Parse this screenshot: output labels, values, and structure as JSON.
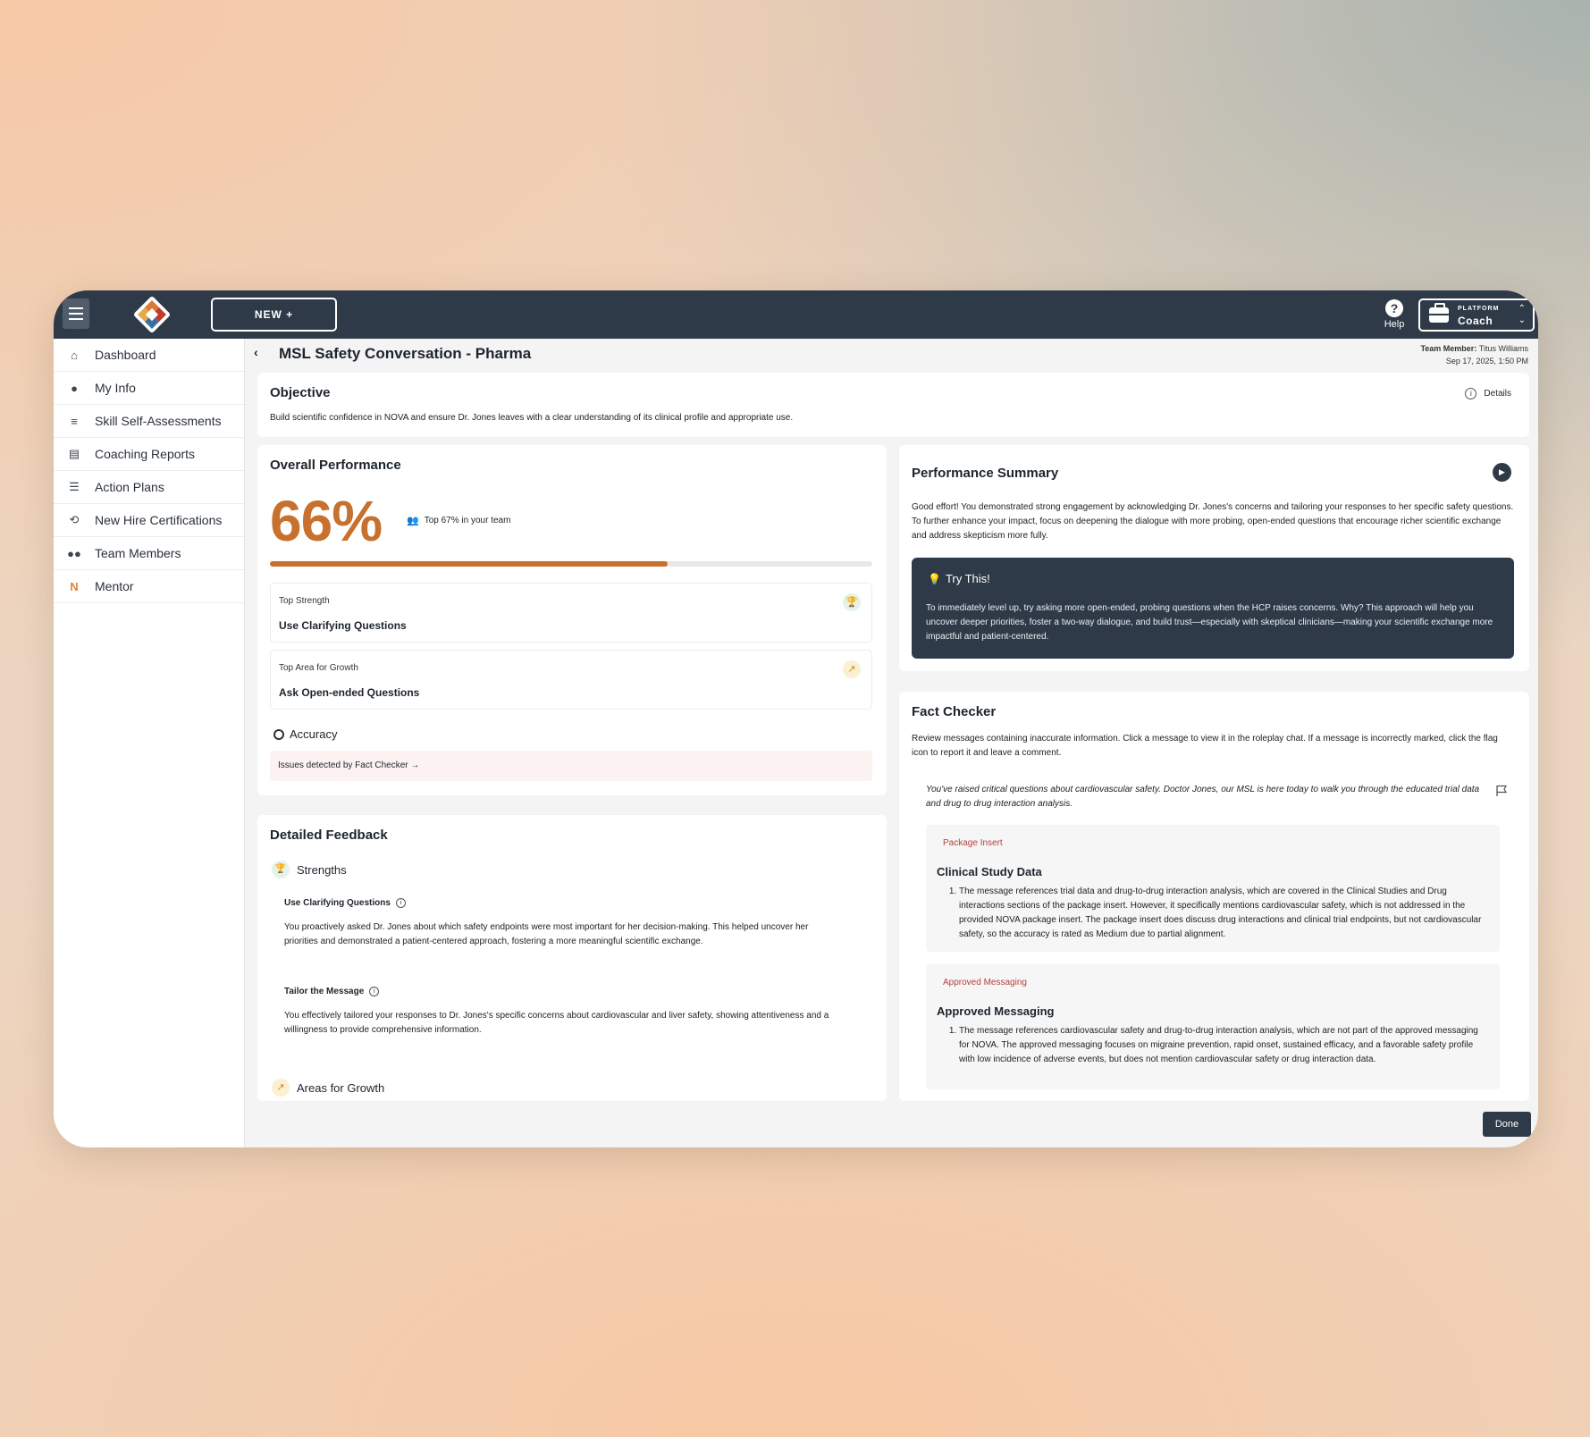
{
  "topbar": {
    "new_label": "NEW  +",
    "help_label": "Help",
    "platform_label": "PLATFORM",
    "platform_value": "Coach"
  },
  "sidebar": {
    "items": [
      {
        "label": "Dashboard",
        "icon": "home-icon"
      },
      {
        "label": "My Info",
        "icon": "user-icon"
      },
      {
        "label": "Skill Self-Assessments",
        "icon": "sliders-icon"
      },
      {
        "label": "Coaching Reports",
        "icon": "report-icon"
      },
      {
        "label": "Action Plans",
        "icon": "list-icon"
      },
      {
        "label": "New Hire Certifications",
        "icon": "cycle-icon"
      },
      {
        "label": "Team Members",
        "icon": "users-icon"
      },
      {
        "label": "Mentor",
        "icon": "mentor-logo-icon"
      }
    ]
  },
  "page": {
    "title": "MSL Safety Conversation - Pharma",
    "team_member_label": "Team Member:",
    "team_member": "Titus Williams",
    "date": "Sep 17, 2025, 1:50 PM"
  },
  "objective": {
    "title": "Objective",
    "text": "Build scientific confidence in NOVA and ensure Dr. Jones leaves with a clear understanding of its clinical profile and appropriate use.",
    "details_label": "Details"
  },
  "performance": {
    "title": "Overall Performance",
    "percent_label": "66%",
    "percent_value": 66,
    "rank": "Top 67% in your team",
    "top_strength_label": "Top Strength",
    "top_strength": "Use Clarifying Questions",
    "growth_label": "Top Area for Growth",
    "growth": "Ask Open-ended Questions",
    "accuracy_title": "Accuracy",
    "accuracy_note": "Issues detected by Fact Checker →"
  },
  "summary": {
    "title": "Performance Summary",
    "text": "Good effort! You demonstrated strong engagement by acknowledging Dr. Jones's concerns and tailoring your responses to her specific safety questions. To further enhance your impact, focus on deepening the dialogue with more probing, open-ended questions that encourage richer scientific exchange and address skepticism more fully.",
    "try_title": "Try This!",
    "try_text": "To immediately level up, try asking more open-ended, probing questions when the HCP raises concerns. Why? This approach will help you uncover deeper priorities, foster a two-way dialogue, and build trust—especially with skeptical clinicians—making your scientific exchange more impactful and patient-centered."
  },
  "feedback": {
    "title": "Detailed Feedback",
    "strengths_title": "Strengths",
    "items": [
      {
        "title": "Use Clarifying Questions",
        "text": "You proactively asked Dr. Jones about which safety endpoints were most important for her decision-making. This helped uncover her priorities and demonstrated a patient-centered approach, fostering a more meaningful scientific exchange."
      },
      {
        "title": "Tailor the Message",
        "text": "You effectively tailored your responses to Dr. Jones's specific concerns about cardiovascular and liver safety, showing attentiveness and a willingness to provide comprehensive information."
      }
    ],
    "growth_title": "Areas for Growth"
  },
  "fact_checker": {
    "title": "Fact Checker",
    "intro": "Review messages containing inaccurate information. Click a message to view it in the roleplay chat. If a message is incorrectly marked, click the flag icon to report it and leave a comment.",
    "message": "You've raised critical questions about cardiovascular safety. Doctor Jones, our MSL is here today to walk you through the educated trial data and drug to drug interaction analysis.",
    "findings": [
      {
        "tag": "Package Insert",
        "title": "Clinical Study Data",
        "text": "The message references trial data and drug-to-drug interaction analysis, which are covered in the Clinical Studies and Drug interactions sections of the package insert. However, it specifically mentions cardiovascular safety, which is not addressed in the provided NOVA package insert. The package insert does discuss drug interactions and clinical trial endpoints, but not cardiovascular safety, so the accuracy is rated as Medium due to partial alignment."
      },
      {
        "tag": "Approved Messaging",
        "title": "Approved Messaging",
        "text": "The message references cardiovascular safety and drug-to-drug interaction analysis, which are not part of the approved messaging for NOVA. The approved messaging focuses on migraine prevention, rapid onset, sustained efficacy, and a favorable safety profile with low incidence of adverse events, but does not mention cardiovascular safety or drug interaction data."
      }
    ]
  },
  "done_label": "Done",
  "colors": {
    "topbar": "#2f3a48",
    "accent": "#c8702e",
    "tag": "#b3413c"
  }
}
